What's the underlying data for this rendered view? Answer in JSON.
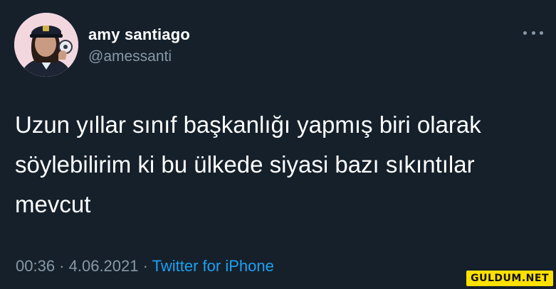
{
  "user": {
    "display_name": "amy santiago",
    "handle": "@amessanti"
  },
  "tweet": {
    "text": "Uzun yıllar sınıf başkanlığı yapmış biri olarak söylebilirim ki bu ülkede siyasi bazı sıkıntılar mevcut"
  },
  "meta": {
    "time": "00:36",
    "separator1": " · ",
    "date": "4.06.2021",
    "separator2": " · ",
    "source": "Twitter for iPhone"
  },
  "watermark": {
    "text": "GULDUM.NET"
  },
  "colors": {
    "background": "#15202b",
    "secondary_text": "#8899a6",
    "link": "#1da1f2",
    "watermark_bg": "#ffe100"
  },
  "icons": {
    "more": "more-horizontal-icon",
    "avatar": "user-avatar-photo"
  }
}
